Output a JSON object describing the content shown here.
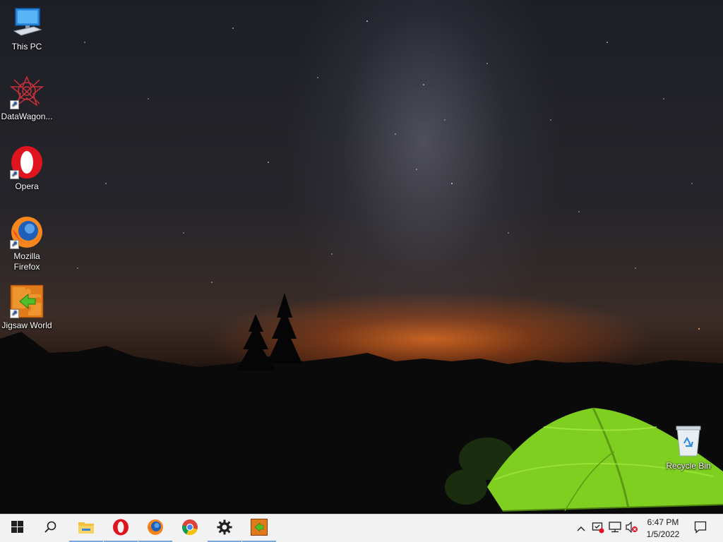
{
  "desktop": {
    "icons": [
      {
        "label": "This PC",
        "icon": "computer-icon"
      },
      {
        "label": "DataWagon...",
        "icon": "datawagon-icon"
      },
      {
        "label": "Opera",
        "icon": "opera-icon"
      },
      {
        "label": "Mozilla Firefox",
        "icon": "firefox-icon"
      },
      {
        "label": "Jigsaw World",
        "icon": "jigsaw-icon"
      }
    ],
    "recycle_bin": {
      "label": "Recycle Bin",
      "icon": "recycle-bin-icon"
    }
  },
  "taskbar": {
    "start": {
      "icon": "windows-logo-icon"
    },
    "search": {
      "icon": "search-icon"
    },
    "pinned": [
      {
        "name": "File Explorer",
        "icon": "folder-icon",
        "active": true
      },
      {
        "name": "Opera",
        "icon": "opera-icon",
        "active": true
      },
      {
        "name": "Mozilla Firefox",
        "icon": "firefox-icon",
        "active": true
      },
      {
        "name": "Google Chrome",
        "icon": "chrome-icon",
        "active": false
      },
      {
        "name": "Settings",
        "icon": "gear-icon",
        "active": true
      },
      {
        "name": "Jigsaw World",
        "icon": "jigsaw-icon",
        "active": true
      }
    ],
    "tray": {
      "icons": [
        "chevron-up-icon",
        "security-icon",
        "network-icon",
        "volume-muted-icon"
      ],
      "time": "6:47 PM",
      "date": "1/5/2022",
      "notification_icon": "notification-icon"
    }
  },
  "colors": {
    "taskbar_bg": "#f2f2f2",
    "active_indicator": "#7aa7dc",
    "tent_green": "#8fdc2a",
    "glow": "#e06a1e"
  }
}
